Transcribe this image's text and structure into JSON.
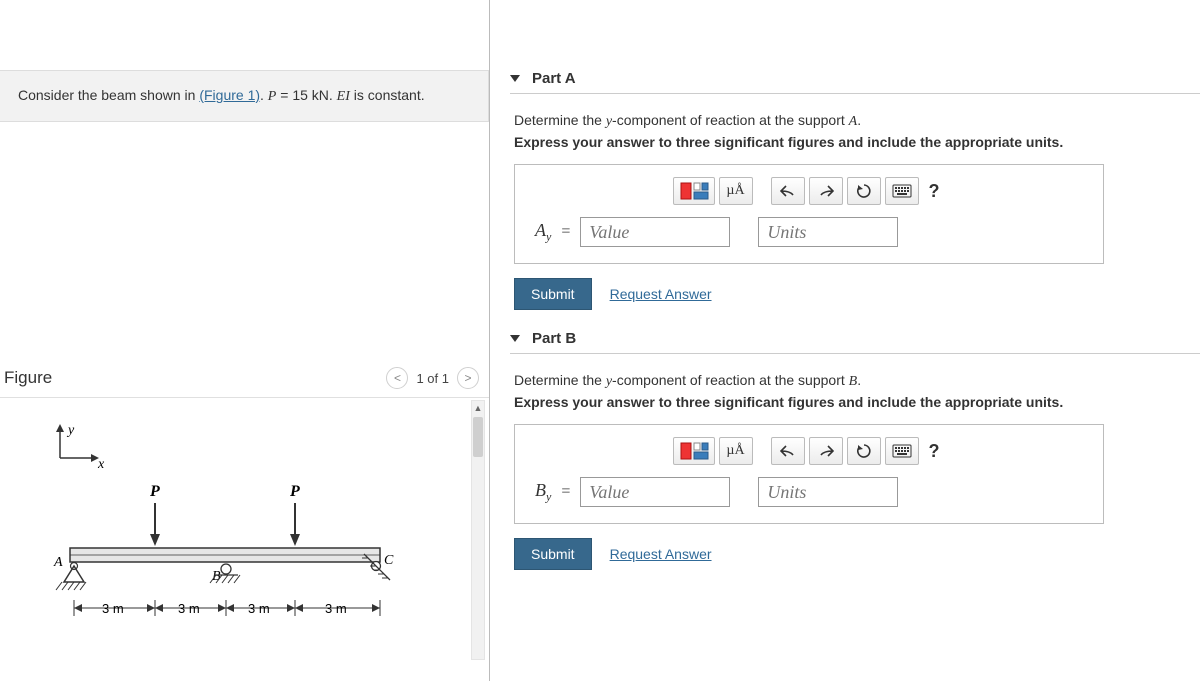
{
  "problem": {
    "prefix": "Consider the beam shown in ",
    "figure_link": "(Figure 1)",
    "suffix1": ". ",
    "pvar": "P",
    "eq_text": " = 15 kN. ",
    "eivar": "EI",
    "suffix2": " is constant."
  },
  "figure": {
    "title": "Figure",
    "nav_prev": "<",
    "nav_count": "1 of 1",
    "nav_next": ">",
    "labels": {
      "y": "y",
      "x": "x",
      "P1": "P",
      "P2": "P",
      "A": "A",
      "B": "B",
      "C": "C",
      "d1": "3 m",
      "d2": "3 m",
      "d3": "3 m",
      "d4": "3 m"
    }
  },
  "partA": {
    "title": "Part A",
    "prompt_prefix": "Determine the ",
    "prompt_var": "y",
    "prompt_mid": "-component of reaction at the support ",
    "prompt_support": "A",
    "prompt_suffix": ".",
    "instruction": "Express your answer to three significant figures and include the appropriate units.",
    "var_label": "A",
    "var_sub": "y",
    "value_placeholder": "Value",
    "units_placeholder": "Units",
    "submit_label": "Submit",
    "request_label": "Request Answer",
    "units_tool": "µÅ",
    "help_label": "?"
  },
  "partB": {
    "title": "Part B",
    "prompt_prefix": "Determine the ",
    "prompt_var": "y",
    "prompt_mid": "-component of reaction at the support ",
    "prompt_support": "B",
    "prompt_suffix": ".",
    "instruction": "Express your answer to three significant figures and include the appropriate units.",
    "var_label": "B",
    "var_sub": "y",
    "value_placeholder": "Value",
    "units_placeholder": "Units",
    "submit_label": "Submit",
    "request_label": "Request Answer",
    "units_tool": "µÅ",
    "help_label": "?"
  }
}
